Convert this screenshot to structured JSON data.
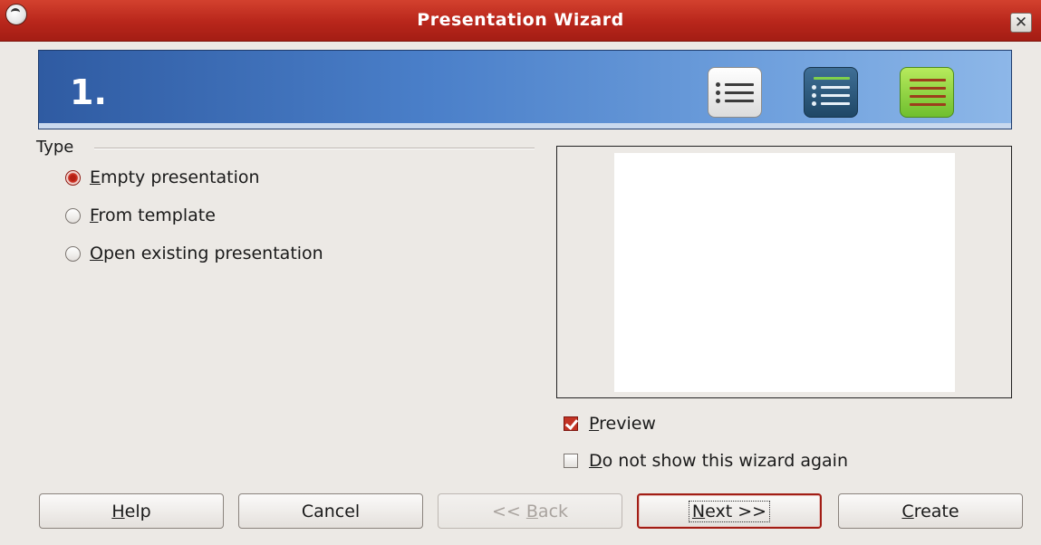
{
  "window": {
    "title": "Presentation Wizard",
    "close_glyph": "✕"
  },
  "banner": {
    "step": "1.",
    "icons": [
      "list-icon",
      "page-list-icon",
      "green-page-icon"
    ]
  },
  "type_group": {
    "label": "Type",
    "options": [
      {
        "mnemonic": "E",
        "rest": "mpty presentation",
        "selected": true
      },
      {
        "mnemonic": "F",
        "rest": "rom template",
        "selected": false
      },
      {
        "mnemonic": "O",
        "rest": "pen existing presentation",
        "selected": false
      }
    ]
  },
  "options": {
    "preview": {
      "mnemonic": "P",
      "rest": "review",
      "checked": true
    },
    "dont_show": {
      "mnemonic": "D",
      "rest": "o not show this wizard again",
      "checked": false
    }
  },
  "buttons": {
    "help": {
      "mnemonic": "H",
      "rest": "elp"
    },
    "cancel": {
      "label": "Cancel"
    },
    "back": {
      "pre": "<< ",
      "mnemonic": "B",
      "rest": "ack",
      "disabled": true
    },
    "next": {
      "mnemonic": "N",
      "rest": "ext >>",
      "default": true
    },
    "create": {
      "mnemonic": "C",
      "rest": "reate"
    }
  },
  "colors": {
    "titlebar": "#b8261b",
    "banner": "#4a7fc9",
    "accent": "#c23324"
  }
}
